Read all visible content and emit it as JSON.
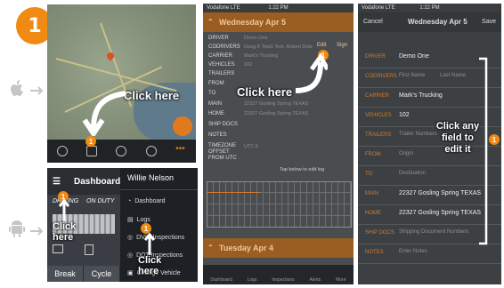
{
  "step": {
    "number": "1"
  },
  "colors": {
    "accent": "#f08a12",
    "header_orange": "#9a5d22"
  },
  "platforms": [
    {
      "icon": "apple-icon"
    },
    {
      "icon": "android-icon"
    }
  ],
  "ios_map": {
    "callout": "Click here",
    "badge": "1"
  },
  "android": {
    "title": "Dashboard",
    "status_left": "DRIVING",
    "status_right": "ON DUTY",
    "drawer_user": "Willie Nelson",
    "drawer_items": [
      "Dashboard",
      "Logs",
      "DVIR Inspections",
      "DOT Inspections",
      "Change Vehicle"
    ],
    "bottom_buttons": [
      "Break",
      "Cycle"
    ],
    "callout_left": "Click here",
    "callout_right": "Click here",
    "badge": "1"
  },
  "logs": {
    "status_bar": "1:22 PM",
    "carrier_status": "Vodafone LTE",
    "day_header": "Wednesday Apr 5",
    "edit_label": "Edit",
    "sign_label": "Sign",
    "fields": [
      {
        "label": "DRIVER",
        "value": "Demo One"
      },
      {
        "label": "CODRIVERS",
        "value": "Doug K Test1 Test, Robert Dole"
      },
      {
        "label": "CARRIER",
        "value": "Mark's Trucking"
      },
      {
        "label": "VEHICLES",
        "value": "102"
      },
      {
        "label": "TRAILERS",
        "value": ""
      },
      {
        "label": "FROM",
        "value": ""
      },
      {
        "label": "TO",
        "value": ""
      },
      {
        "label": "MAIN",
        "value": "22327 Gosling Spring TEXAS"
      },
      {
        "label": "HOME",
        "value": "22327 Gosling Spring TEXAS"
      },
      {
        "label": "SHIP DOCS",
        "value": ""
      },
      {
        "label": "NOTES",
        "value": ""
      },
      {
        "label": "TIMEZONE OFFSET FROM UTC",
        "value": "UTC-5"
      }
    ],
    "hint": "Tap below to edit log",
    "next_day": "Tuesday Apr 4",
    "tabs": [
      "Dashboard",
      "Logs",
      "Inspections",
      "Alerts",
      "More"
    ],
    "callout": "Click here",
    "badge": "1"
  },
  "edit": {
    "cancel": "Cancel",
    "title": "Wednesday Apr 5",
    "save": "Save",
    "carrier_status": "Vodafone LTE",
    "status_bar": "1:22 PM",
    "rows": [
      {
        "label": "DRIVER",
        "value": "Demo One",
        "dim": false
      },
      {
        "label": "CODRIVERS",
        "value": "First Name          Last Name",
        "dim": true
      },
      {
        "label": "CARRIER",
        "value": "Mark's Trucking",
        "dim": false
      },
      {
        "label": "VEHICLES",
        "value": "102",
        "dim": false
      },
      {
        "label": "TRAILERS",
        "value": "Trailer Numbers",
        "dim": true
      },
      {
        "label": "FROM",
        "value": "Origin",
        "dim": true
      },
      {
        "label": "TO",
        "value": "Destination",
        "dim": true
      },
      {
        "label": "MAIN",
        "value": "22327 Gosling Spring TEXAS",
        "dim": false
      },
      {
        "label": "HOME",
        "value": "22327 Gosling Spring TEXAS",
        "dim": false
      },
      {
        "label": "SHIP DOCS",
        "value": "Shipping Document Numbers",
        "dim": true
      },
      {
        "label": "NOTES",
        "value": "Enter Notes",
        "dim": true
      }
    ],
    "callout": "Click any field to edit it",
    "badge": "1"
  }
}
